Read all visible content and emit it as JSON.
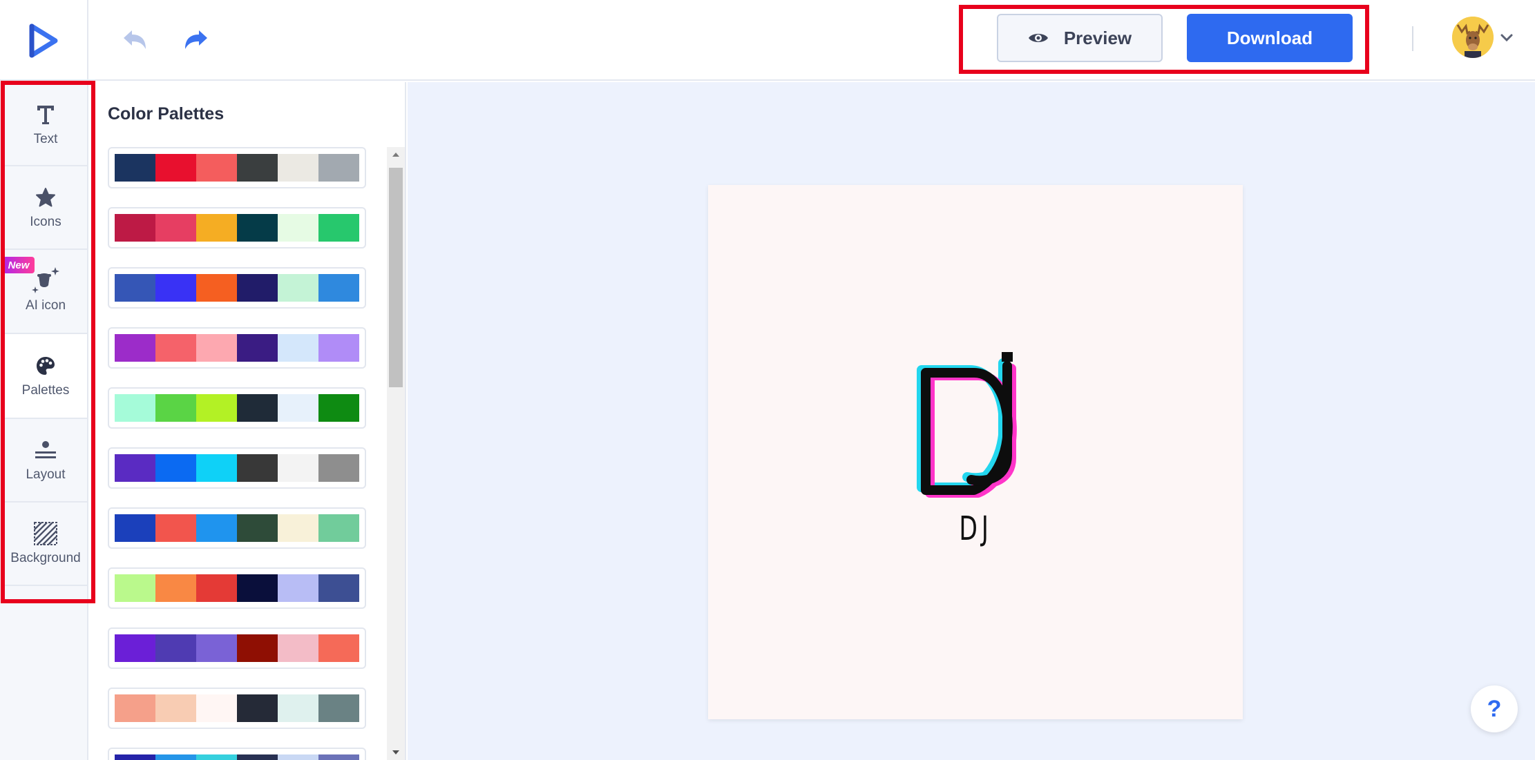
{
  "header": {
    "preview_label": "Preview",
    "download_label": "Download"
  },
  "rail": {
    "items": [
      {
        "label": "Text",
        "icon": "text-icon"
      },
      {
        "label": "Icons",
        "icon": "star-icon"
      },
      {
        "label": "AI icon",
        "icon": "ai-sparkle-icon",
        "badge": "New"
      },
      {
        "label": "Palettes",
        "icon": "palette-icon"
      },
      {
        "label": "Layout",
        "icon": "layout-icon"
      },
      {
        "label": "Background",
        "icon": "background-hatch-icon"
      }
    ],
    "active": "Palettes"
  },
  "panel": {
    "title": "Color Palettes",
    "palettes": [
      [
        "#1b3460",
        "#e8102e",
        "#f45d5d",
        "#3a3e3f",
        "#ebe9e3",
        "#a2a9b0"
      ],
      [
        "#bd1a45",
        "#e63e62",
        "#f5ad23",
        "#053b48",
        "#e6fbe4",
        "#27c86d"
      ],
      [
        "#3556b6",
        "#3932f5",
        "#f55f21",
        "#211c69",
        "#c4f3d6",
        "#2f89de"
      ],
      [
        "#9c2cc9",
        "#f5626a",
        "#fda8b0",
        "#3a1c83",
        "#d4e7fb",
        "#b08cf7"
      ],
      [
        "#a5fbd9",
        "#5ad445",
        "#b3f125",
        "#1f2b38",
        "#e7f1fb",
        "#0e8b12"
      ],
      [
        "#5a2bc2",
        "#0b6af2",
        "#0fd1f7",
        "#383838",
        "#f3f3f3",
        "#8e8e8e"
      ],
      [
        "#1b40bb",
        "#f2554d",
        "#1f94ee",
        "#2e4b39",
        "#f8f1d9",
        "#71cc9b"
      ],
      [
        "#baf98c",
        "#f98844",
        "#e43a36",
        "#0a0f3b",
        "#b8bdf5",
        "#3d4f93"
      ],
      [
        "#6b1fd7",
        "#4f3bb2",
        "#7a62d6",
        "#8f0f03",
        "#f3bcc7",
        "#f56a58"
      ],
      [
        "#f5a08a",
        "#f8ccb3",
        "#fff6f4",
        "#252a37",
        "#dff1ee",
        "#6a8284"
      ],
      [
        "#2523a8",
        "#2595e8",
        "#35d0de",
        "#283052",
        "#c9d8f4",
        "#6b72b8"
      ]
    ]
  },
  "canvas": {
    "logo_text": "DJ"
  },
  "help": {
    "label": "?"
  },
  "colors": {
    "accent": "#2e6af0",
    "highlight": "#e8001c",
    "canvas_bg": "#edf2fd",
    "artboard_bg": "#fdf6f6"
  }
}
